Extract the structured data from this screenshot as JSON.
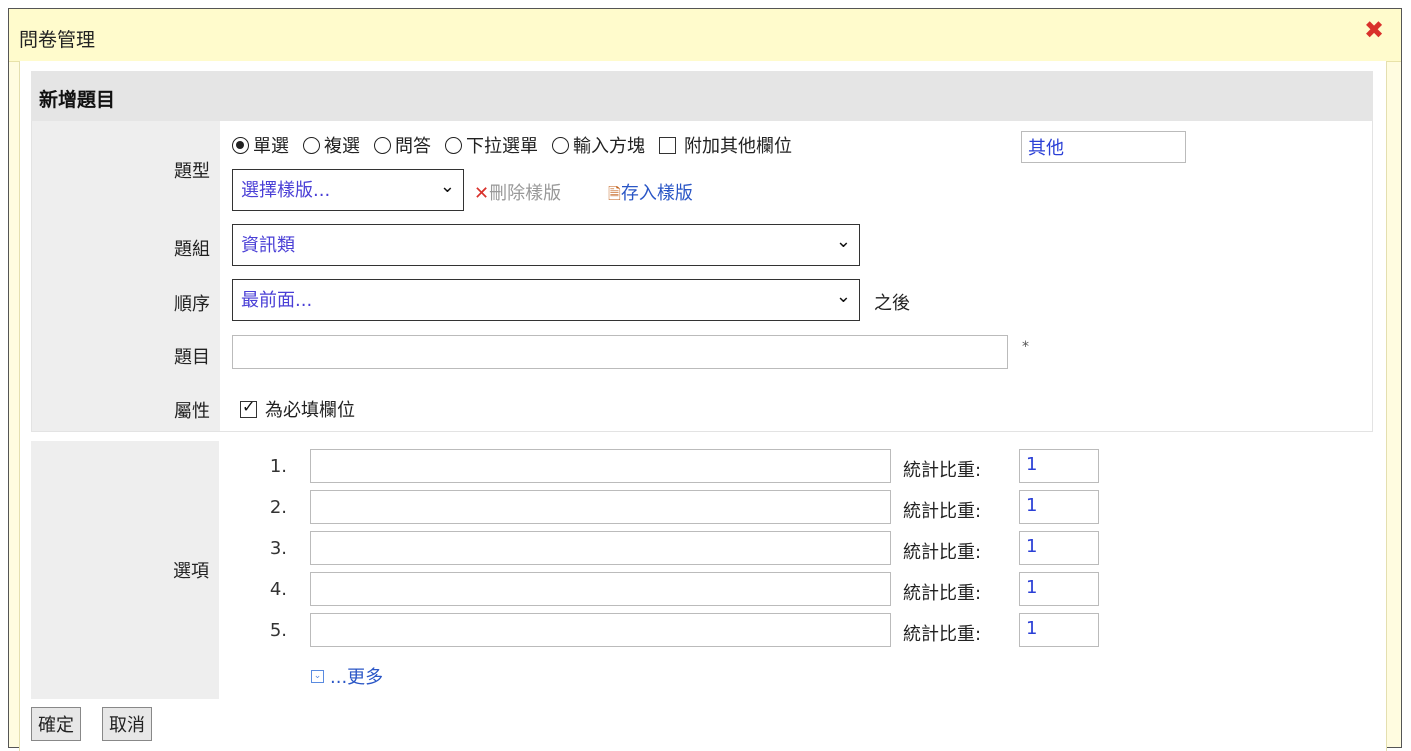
{
  "dialog": {
    "title": "問卷管理",
    "close_icon": "close-icon"
  },
  "section": {
    "title": "新增題目"
  },
  "form": {
    "type_label": "題型",
    "type_options": [
      {
        "label": "單選",
        "selected": true
      },
      {
        "label": "複選",
        "selected": false
      },
      {
        "label": "問答",
        "selected": false
      },
      {
        "label": "下拉選單",
        "selected": false
      },
      {
        "label": "輸入方塊",
        "selected": false
      }
    ],
    "extra_field_label": "附加其他欄位",
    "extra_field_checked": false,
    "extra_field_value": "其他",
    "template_select": "選擇樣版...",
    "delete_template": "刪除樣版",
    "save_template": "存入樣版",
    "group_label": "題組",
    "group_value": "資訊類",
    "order_label": "順序",
    "order_value": "最前面...",
    "order_suffix": "之後",
    "question_label": "題目",
    "question_value": "",
    "required_mark": "*",
    "attr_label": "屬性",
    "attr_required_label": "為必填欄位",
    "attr_required_checked": true
  },
  "options": {
    "label": "選項",
    "items": [
      {
        "num": "1.",
        "value": "",
        "weight_label": "統計比重:",
        "weight": "1"
      },
      {
        "num": "2.",
        "value": "",
        "weight_label": "統計比重:",
        "weight": "1"
      },
      {
        "num": "3.",
        "value": "",
        "weight_label": "統計比重:",
        "weight": "1"
      },
      {
        "num": "4.",
        "value": "",
        "weight_label": "統計比重:",
        "weight": "1"
      },
      {
        "num": "5.",
        "value": "",
        "weight_label": "統計比重:",
        "weight": "1"
      }
    ],
    "more_label": "...更多"
  },
  "buttons": {
    "ok": "確定",
    "cancel": "取消"
  },
  "colors": {
    "accent_link": "#2a56c6",
    "delete_icon": "#d9312b",
    "title_bg": "#fffbcc"
  }
}
